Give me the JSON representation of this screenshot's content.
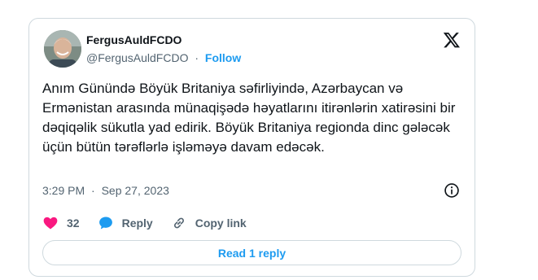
{
  "author": {
    "name": "FergusAuldFCDO",
    "handle": "@FergusAuldFCDO",
    "separator": "·",
    "follow_label": "Follow"
  },
  "tweet": {
    "text": "Anım Günündə Böyük Britaniya səfirliyində, Azərbaycan və Ermənistan arasında münaqişədə həyatlarını itirənlərin xatirəsini bir dəqiqəlik sükutla yad edirik. Böyük Britaniya regionda dinc gələcək üçün bütün tərəflərlə işləməyə davam edəcək.",
    "time": "3:29 PM",
    "date_separator": "·",
    "date": "Sep 27, 2023"
  },
  "actions": {
    "like_count": "32",
    "reply_label": "Reply",
    "copy_link_label": "Copy link"
  },
  "read_replies_label": "Read 1 reply",
  "icons": {
    "x_logo": "x-logo-icon",
    "info": "info-icon",
    "like": "heart-icon",
    "reply": "speech-bubble-icon",
    "copy_link": "link-icon"
  },
  "colors": {
    "accent": "#1d9bf0",
    "like": "#f91880",
    "text": "#0f1419",
    "muted": "#536471",
    "border": "#cfd9de"
  }
}
